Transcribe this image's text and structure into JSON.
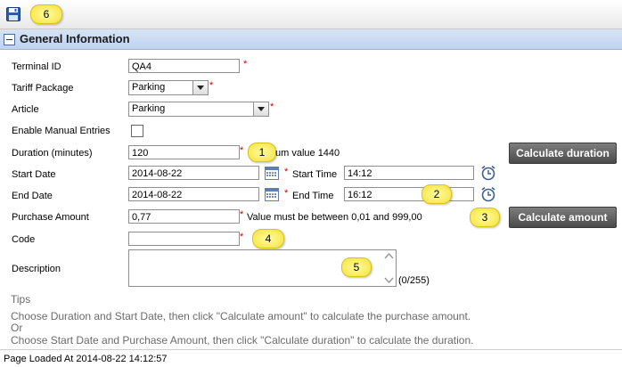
{
  "toolbar": {
    "save_icon": "floppy-disk-icon"
  },
  "callouts": [
    "1",
    "2",
    "3",
    "4",
    "5",
    "6"
  ],
  "panel": {
    "title": "General Information"
  },
  "form": {
    "terminal_id": {
      "label": "Terminal ID",
      "value": "QA4"
    },
    "tariff_package": {
      "label": "Tariff Package",
      "value": "Parking"
    },
    "article": {
      "label": "Article",
      "value": "Parking"
    },
    "manual_entries": {
      "label": "Enable Manual Entries",
      "checked": false
    },
    "duration": {
      "label": "Duration (minutes)",
      "value": "120",
      "hint_prefix": "M",
      "hint_suffix": "um value 1440"
    },
    "start_date": {
      "label": "Start Date",
      "value": "2014-08-22"
    },
    "start_time": {
      "label": "Start Time",
      "value": "14:12"
    },
    "end_date": {
      "label": "End Date",
      "value": "2014-08-22"
    },
    "end_time": {
      "label": "End Time",
      "value": "16:12"
    },
    "purchase_amount": {
      "label": "Purchase Amount",
      "value": "0,77",
      "hint": "Value must be between 0,01 and 999,00"
    },
    "code": {
      "label": "Code",
      "value": ""
    },
    "description": {
      "label": "Description",
      "value": "",
      "counter": "(0/255)"
    },
    "required_mark": "*"
  },
  "buttons": {
    "calculate_duration": "Calculate duration",
    "calculate_amount": "Calculate amount"
  },
  "tips": {
    "title": "Tips",
    "line1": "Choose Duration and Start Date, then click \"Calculate amount\" to calculate the purchase amount.",
    "line2": "Or",
    "line3": "Choose Start Date and Purchase Amount, then click \"Calculate duration\" to calculate the duration."
  },
  "footer": {
    "status": "Page Loaded At 2014-08-22 14:12:57"
  },
  "colors": {
    "panel_header": "#c9daf2",
    "required": "#d00000",
    "callout": "#f6e23a",
    "dark_button": "#5a5a5a"
  }
}
